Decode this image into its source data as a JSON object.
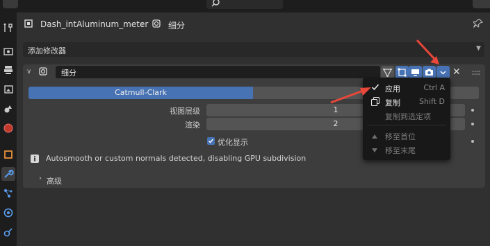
{
  "header": {
    "object_name": "Dash_intAluminum_meter",
    "modifier_breadcrumb": "细分"
  },
  "add_modifier_label": "添加修改器",
  "modifier": {
    "name": "细分",
    "mode_active": "Catmull-Clark",
    "mode_inactive": "",
    "viewport_levels_label": "视图层级",
    "viewport_levels_value": "1",
    "render_label": "渲染",
    "render_value": "2",
    "optimal_display_label": "优化显示",
    "optimal_display_checked": true,
    "info_message": "Autosmooth or custom normals detected, disabling GPU subdivision",
    "advanced_label": "高级"
  },
  "context_menu": {
    "items": [
      {
        "label": "应用",
        "shortcut": "Ctrl A",
        "icon": "check-icon",
        "enabled": true
      },
      {
        "label": "复制",
        "shortcut": "Shift D",
        "icon": "duplicate-icon",
        "enabled": true
      },
      {
        "label": "复制到选定项",
        "shortcut": "",
        "icon": "",
        "enabled": false
      },
      {
        "label": "移至首位",
        "shortcut": "",
        "icon": "triangle-up-icon",
        "enabled": false
      },
      {
        "label": "移至末尾",
        "shortcut": "",
        "icon": "triangle-down-icon",
        "enabled": false
      }
    ]
  },
  "colors": {
    "accent": "#4772b3",
    "annotation_arrow": "#e8473a",
    "panel_bg": "#3d3d3d",
    "window_bg": "#303030"
  }
}
